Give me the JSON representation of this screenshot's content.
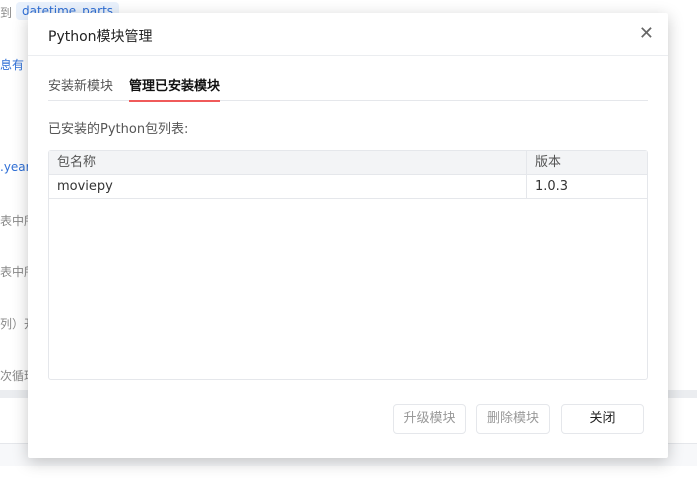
{
  "background": {
    "chip": "datetime_parts",
    "prefix": "到",
    "lines": [
      "息有",
      ".year",
      "表中所",
      "表中所",
      "列）开",
      "次循环"
    ]
  },
  "dialog": {
    "title": "Python模块管理",
    "close_icon": "close-icon",
    "tabs": [
      {
        "label": "安装新模块",
        "active": false
      },
      {
        "label": "管理已安装模块",
        "active": true
      }
    ],
    "list_label": "已安装的Python包列表:",
    "table": {
      "columns": [
        "包名称",
        "版本"
      ],
      "rows": [
        [
          "moviepy",
          "1.0.3"
        ]
      ]
    },
    "buttons": {
      "upgrade": "升级模块",
      "delete": "删除模块",
      "close": "关闭"
    }
  }
}
